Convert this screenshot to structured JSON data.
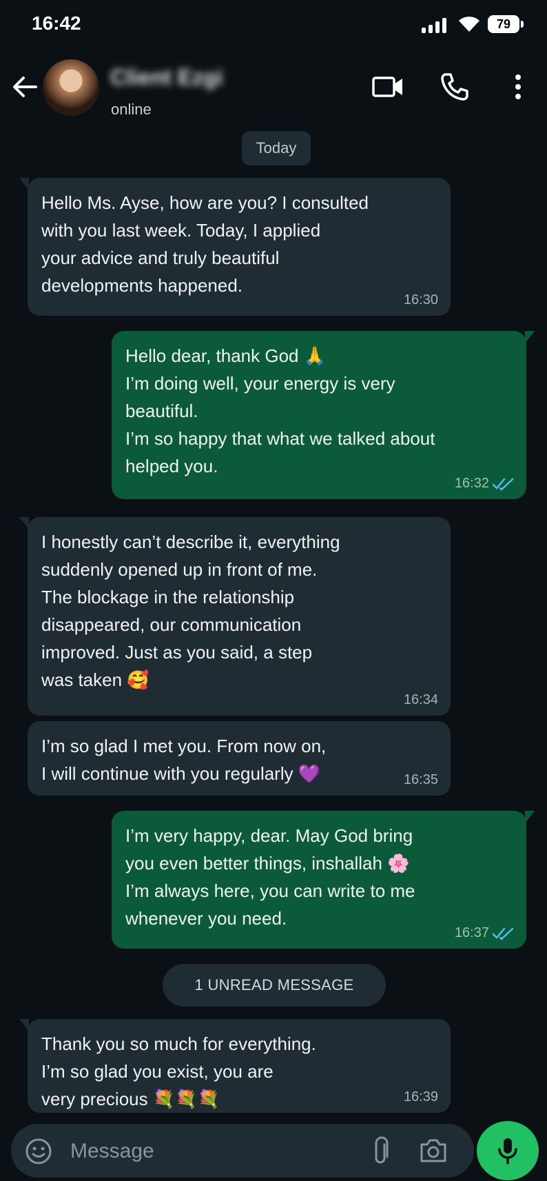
{
  "status_bar": {
    "time": "16:42",
    "battery": "79"
  },
  "header": {
    "contact_name": "Client Ezgi",
    "contact_status": "online"
  },
  "date_divider": "Today",
  "messages": [
    {
      "direction": "incoming",
      "text": "Hello Ms. Ayse, how are you? I consulted\nwith you last week. Today, I applied\nyour advice and truly beautiful\ndevelopments happened.",
      "time": "16:30"
    },
    {
      "direction": "outgoing",
      "text": "Hello dear, thank God 🙏\nI’m doing well, your energy is very\nbeautiful.\nI’m so happy that what we talked about\nhelped you.",
      "time": "16:32",
      "status": "read"
    },
    {
      "direction": "incoming",
      "text": "I honestly can’t describe it, everything\nsuddenly opened up in front of me.\nThe blockage in the relationship\ndisappeared, our communication\nimproved. Just as you said, a step\nwas taken 🥰",
      "time": "16:34"
    },
    {
      "direction": "incoming",
      "text": "I’m so glad I met you. From now on,\nI will continue with you regularly 💜",
      "time": "16:35"
    },
    {
      "direction": "outgoing",
      "text": "I’m very happy, dear. May God bring\nyou even better things, inshallah 🌸\nI’m always here, you can write to me\nwhenever you need.",
      "time": "16:37",
      "status": "read"
    },
    {
      "direction": "incoming",
      "text": "Thank you so much for everything.\nI’m so glad you exist, you are\nvery precious 💐💐💐",
      "time": "16:39"
    }
  ],
  "unread_divider": "1 UNREAD MESSAGE",
  "composer": {
    "placeholder": "Message"
  },
  "icons": [
    "back-arrow-icon",
    "video-call-icon",
    "phone-icon",
    "more-options-icon",
    "emoji-icon",
    "attach-icon",
    "camera-icon",
    "mic-icon",
    "read-ticks-icon"
  ],
  "colors": {
    "background": "#0b1014",
    "incoming_bubble": "#1f2c33",
    "outgoing_bubble": "#0b5a3a",
    "accent": "#21c063",
    "read_ticks": "#53bdeb"
  }
}
